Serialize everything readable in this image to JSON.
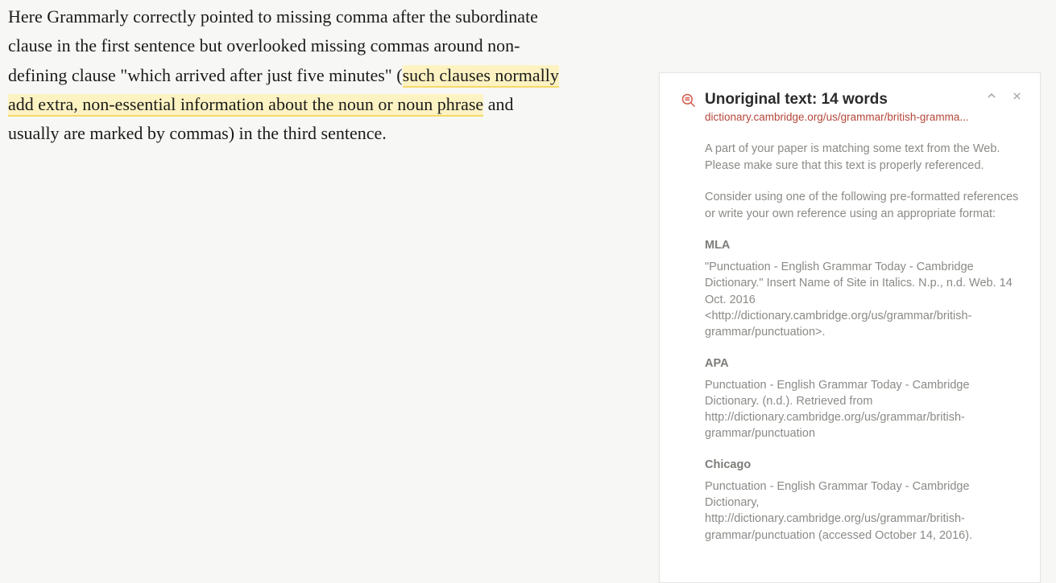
{
  "main": {
    "text_before_highlight": "Here Grammarly correctly pointed to missing comma after the subordinate clause in the first sentence but overlooked missing commas around non-defining clause \"which arrived after just five minutes\" (",
    "highlighted_text": "such clauses normally add extra, non-essential information about the noun or noun phrase",
    "text_after_highlight": " and usually are marked by commas) in the third sentence."
  },
  "card": {
    "title": "Unoriginal text: 14 words",
    "source": "dictionary.cambridge.org/us/grammar/british-gramma...",
    "intro1": "A part of your paper is matching some text from the Web. Please make sure that this text is properly referenced.",
    "intro2": "Consider using one of the following pre-formatted references or write your own reference using an appropriate format:",
    "references": {
      "mla_label": "MLA",
      "mla_text": "\"Punctuation - English Grammar Today - Cambridge Dictionary.\" Insert Name of Site in Italics. N.p., n.d. Web. 14 Oct. 2016 <http://dictionary.cambridge.org/us/grammar/british-grammar/punctuation>.",
      "apa_label": "APA",
      "apa_text": "Punctuation - English Grammar Today - Cambridge Dictionary. (n.d.). Retrieved from http://dictionary.cambridge.org/us/grammar/british-grammar/punctuation",
      "chicago_label": "Chicago",
      "chicago_text": "Punctuation - English Grammar Today - Cambridge Dictionary, http://dictionary.cambridge.org/us/grammar/british-grammar/punctuation (accessed October 14, 2016)."
    }
  }
}
